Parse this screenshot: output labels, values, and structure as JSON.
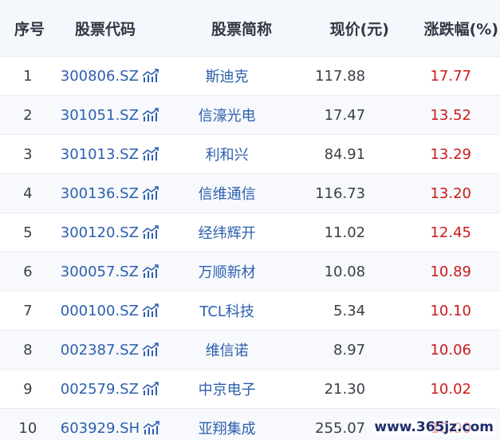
{
  "headers": {
    "index": "序号",
    "code": "股票代码",
    "name": "股票简称",
    "price": "现价(元)",
    "change": "涨跌幅(%)"
  },
  "rows": [
    {
      "index": "1",
      "code": "300806.SZ",
      "name": "斯迪克",
      "price": "117.88",
      "change": "17.77"
    },
    {
      "index": "2",
      "code": "301051.SZ",
      "name": "信濠光电",
      "price": "17.47",
      "change": "13.52"
    },
    {
      "index": "3",
      "code": "301013.SZ",
      "name": "利和兴",
      "price": "84.91",
      "change": "13.29"
    },
    {
      "index": "4",
      "code": "300136.SZ",
      "name": "信维通信",
      "price": "116.73",
      "change": "13.20"
    },
    {
      "index": "5",
      "code": "300120.SZ",
      "name": "经纬辉开",
      "price": "11.02",
      "change": "12.45"
    },
    {
      "index": "6",
      "code": "300057.SZ",
      "name": "万顺新材",
      "price": "10.08",
      "change": "10.89"
    },
    {
      "index": "7",
      "code": "000100.SZ",
      "name": "TCL科技",
      "price": "5.34",
      "change": "10.10"
    },
    {
      "index": "8",
      "code": "002387.SZ",
      "name": "维信诺",
      "price": "8.97",
      "change": "10.06"
    },
    {
      "index": "9",
      "code": "002579.SZ",
      "name": "中京电子",
      "price": "21.30",
      "change": "10.02"
    },
    {
      "index": "10",
      "code": "603929.SH",
      "name": "亚翔集成",
      "price": "255.07",
      "change": "10.00"
    }
  ],
  "watermark": "www.365jz.com",
  "colors": {
    "link": "#2d5fae",
    "up": "#cc1a1a",
    "header_bg": "#f4f7fb"
  }
}
